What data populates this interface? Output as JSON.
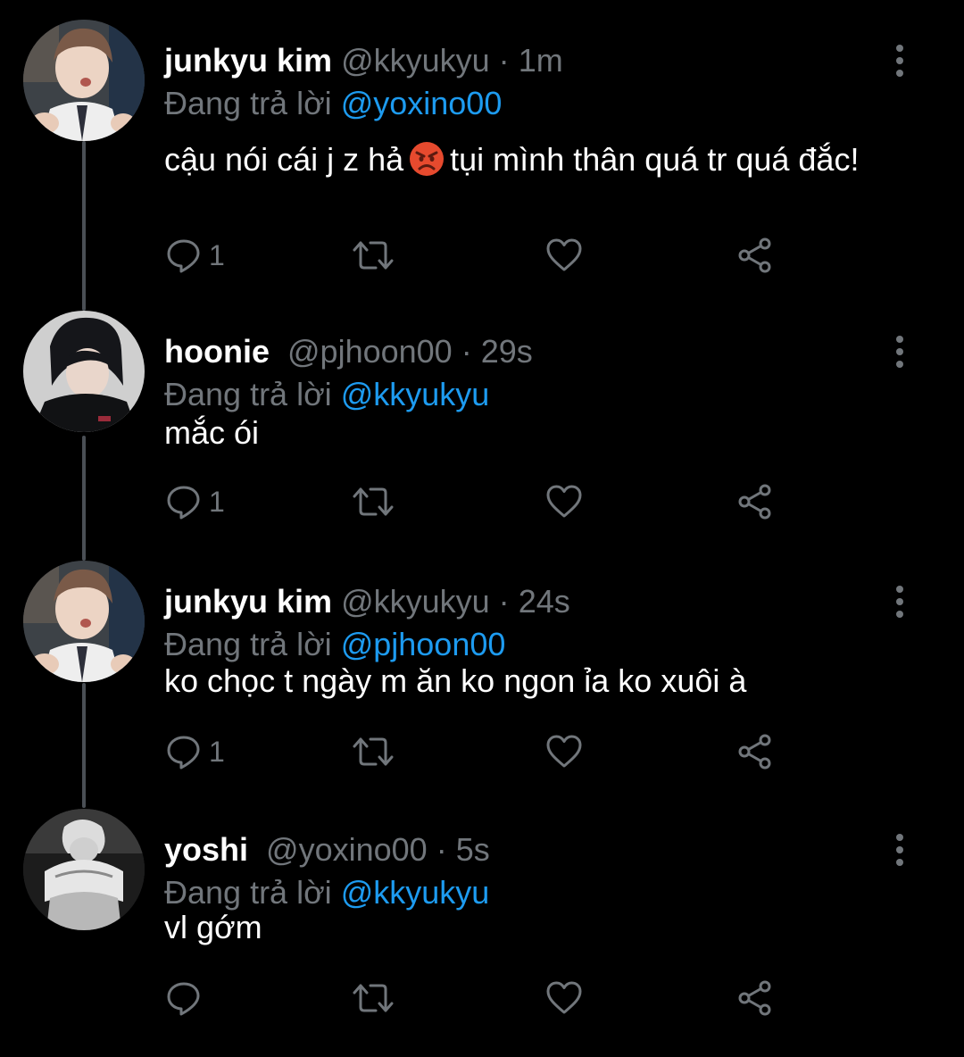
{
  "colors": {
    "background": "#000000",
    "name": "#ffffff",
    "secondary": "#71767b",
    "link": "#1d9bf0",
    "thread_line": "#4a4f55"
  },
  "icons": {
    "reply": "reply-icon",
    "retweet": "retweet-icon",
    "like": "like-icon",
    "share": "share-icon",
    "more": "more-vertical-icon"
  },
  "tweets": [
    {
      "name": "junkyu kim",
      "handle": "@kkyukyu",
      "separator": "·",
      "time": "1m",
      "reply_prefix": "Đang trả lời",
      "reply_to": "@yoxino00",
      "text_before_emoji": "cậu nói cái j z hả",
      "emoji": "😡",
      "text_after_emoji": "tụi mình thân quá tr quá đắc!",
      "reply_count": "1"
    },
    {
      "name": "hoonie",
      "handle": "@pjhoon00",
      "separator": "·",
      "time": "29s",
      "reply_prefix": "Đang trả lời",
      "reply_to": "@kkyukyu",
      "text": "mắc ói",
      "reply_count": "1"
    },
    {
      "name": "junkyu kim",
      "handle": "@kkyukyu",
      "separator": "·",
      "time": "24s",
      "reply_prefix": "Đang trả lời",
      "reply_to": "@pjhoon00",
      "text": "ko chọc t ngày m ăn ko ngon ỉa ko xuôi à",
      "reply_count": "1"
    },
    {
      "name": "yoshi",
      "handle": "@yoxino00",
      "separator": "·",
      "time": "5s",
      "reply_prefix": "Đang trả lời",
      "reply_to": "@kkyukyu",
      "text": "vl gớm",
      "reply_count": ""
    }
  ]
}
